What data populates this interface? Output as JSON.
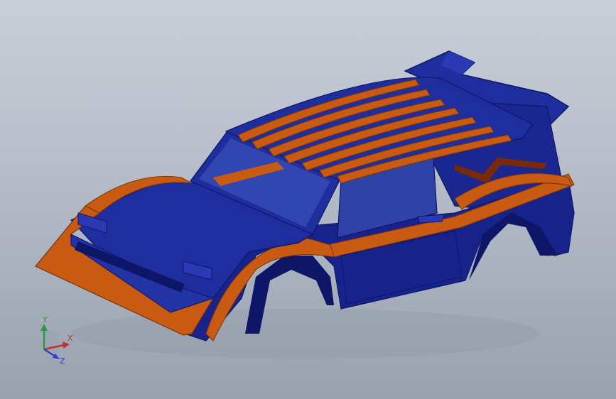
{
  "viewport": {
    "background_top": "#c9cfd9",
    "background_bottom": "#99a1af"
  },
  "model": {
    "body_color": "#1f2e9e",
    "body_dark": "#0d1667",
    "trim_color": "#c85a12",
    "trim_dark": "#7a3408",
    "glass_color": "#3a4fb8"
  },
  "triad": {
    "x_label": "X",
    "y_label": "Y",
    "z_label": "Z",
    "x_color": "#c0332b",
    "y_color": "#2e9a3a",
    "z_color": "#2a3fc4"
  }
}
